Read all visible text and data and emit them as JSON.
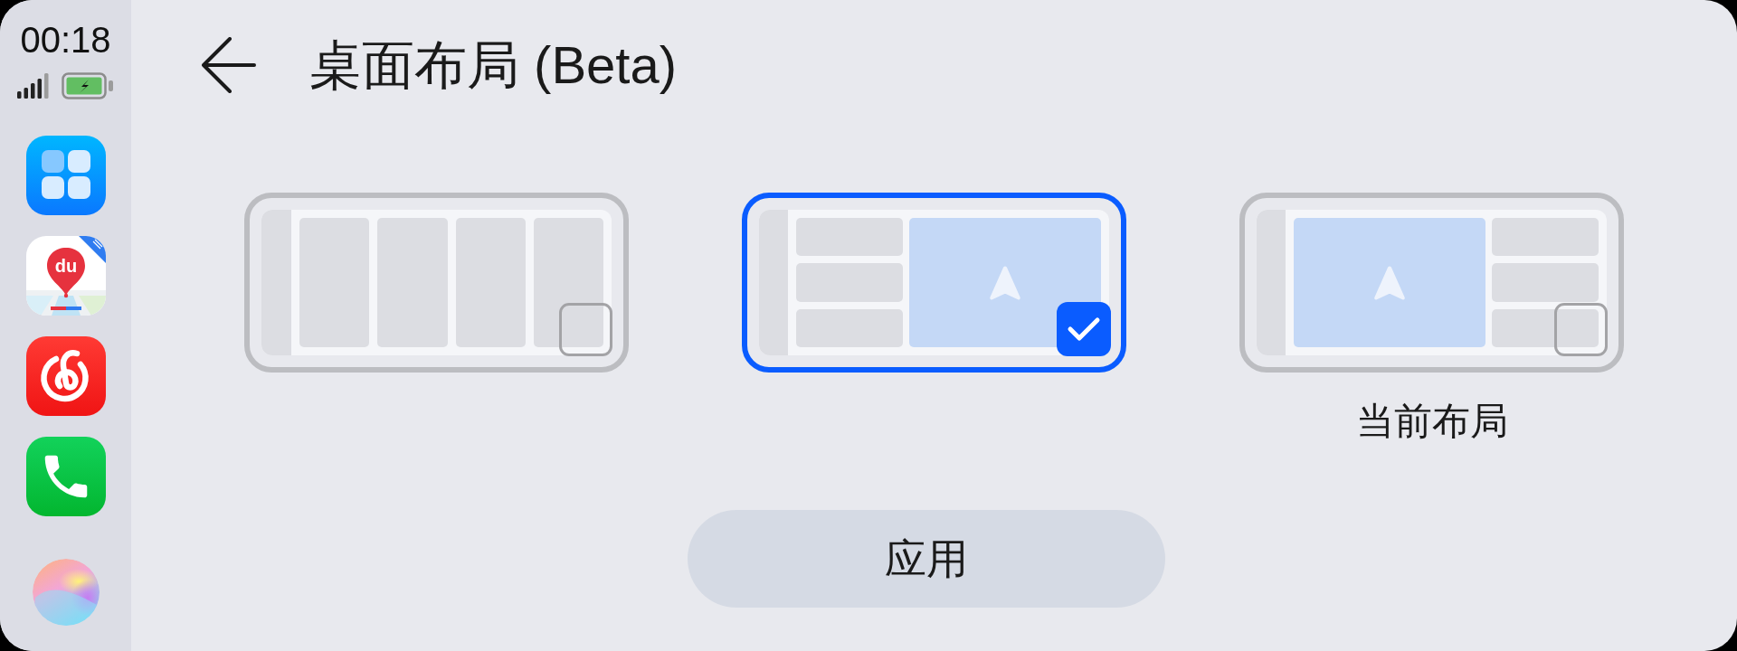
{
  "status_bar": {
    "time": "00:18"
  },
  "dock": {
    "map_logo": "du"
  },
  "header": {
    "title": "桌面布局 (Beta)"
  },
  "layouts": [
    {
      "kind": "four-columns",
      "selected": false
    },
    {
      "kind": "list-left-map-right",
      "selected": true
    },
    {
      "kind": "map-left-list-right",
      "selected": false,
      "caption": "当前布局"
    }
  ],
  "apply_button": {
    "label": "应用"
  }
}
